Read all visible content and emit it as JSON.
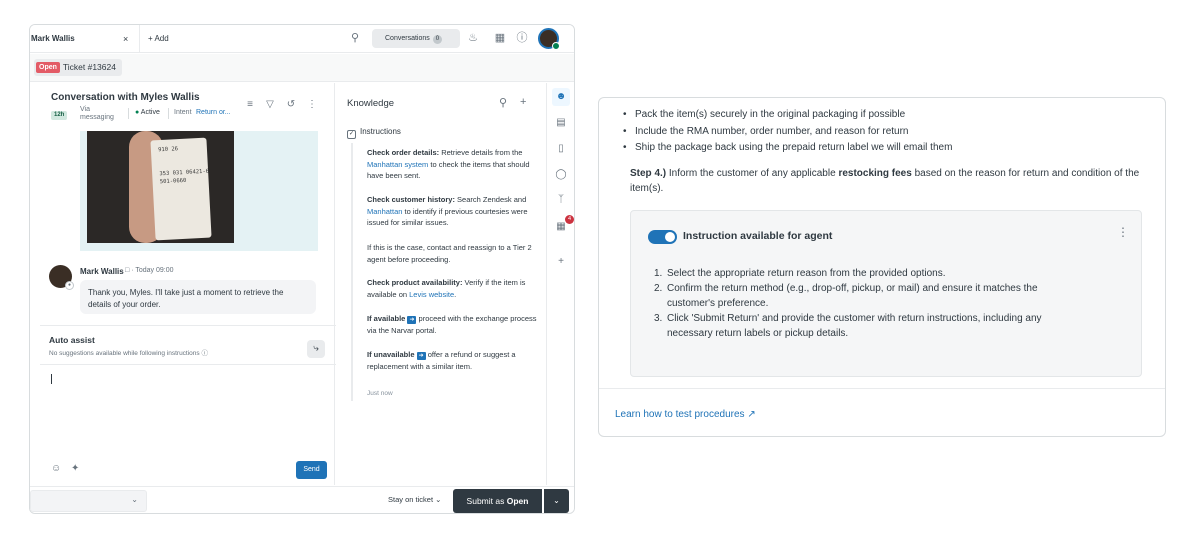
{
  "topbar": {
    "tab_label": "Mark Wallis",
    "tab_close": "×",
    "add_label": "+ Add",
    "conversations_label": "Conversations",
    "conversations_count": "0"
  },
  "ticket": {
    "status": "Open",
    "label": "Ticket #13624"
  },
  "conversation": {
    "title": "Conversation with Myles Wallis",
    "age_badge": "12h",
    "via": "Via messaging",
    "status": "Active",
    "intent_label": "Intent",
    "intent_value": "Return or...",
    "image_text": "910 26\n\n353 031 06421-6\n501-0660",
    "message": {
      "author": "Mark Wallis",
      "time": "· Today 09:00",
      "text": "Thank you, Myles. I'll take just a moment to retrieve the details of your order."
    },
    "auto_assist": {
      "title": "Auto assist",
      "subtitle": "No suggestions available while following instructions"
    },
    "send_label": "Send"
  },
  "knowledge": {
    "title": "Knowledge",
    "instructions_label": "Instructions",
    "p1_bold": "Check order details:",
    "p1_pre": " Retrieve details from the ",
    "p1_link": "Manhattan system",
    "p1_post": " to check the items that should have been sent.",
    "p2_bold": "Check customer history:",
    "p2_pre": " Search Zendesk and ",
    "p2_link": "Manhattan",
    "p2_post": " to identify if previous courtesies were issued for similar issues.",
    "p3": "If this is the case, contact and reassign to a Tier 2 agent before proceeding.",
    "p4_bold": "Check product availability:",
    "p4_pre": " Verify if the item is available on ",
    "p4_link": "Levis website",
    "p4_post": ".",
    "p5_bold": "If available",
    "p5_post": " proceed with the exchange process via the Narvar portal.",
    "p6_bold": "If unavailable",
    "p6_post": " offer a refund or suggest a replacement with a similar item.",
    "timestamp": "Just now"
  },
  "rail": {
    "badge_count": "4"
  },
  "footer": {
    "stay_label": "Stay on ticket",
    "submit_prefix": "Submit as ",
    "submit_status": "Open"
  },
  "card": {
    "bullets": [
      "Pack the item(s) securely in the original packaging if possible",
      "Include the RMA number, order number, and reason for return",
      "Ship the package back using the prepaid return label we will email them"
    ],
    "step4_label": "Step 4.)",
    "step4_pre": " Inform the customer of any applicable ",
    "step4_bold": "restocking fees",
    "step4_post": " based on the reason for return and condition of the item(s).",
    "toggle_label": "Instruction available for agent",
    "steps": [
      "Select the appropriate return reason from the provided options.",
      "Confirm the return method (e.g., drop-off, pickup, or mail) and ensure it matches the customer's preference.",
      "Click 'Submit Return' and provide the customer with return instructions, including any necessary return labels or pickup details."
    ],
    "learn_link": "Learn how to test procedures"
  },
  "colors": {
    "brand_blue": "#1f73b7",
    "open_red": "#e35b66",
    "active_green": "#038153",
    "submit_dark": "#2f3941"
  },
  "icons": [
    "search-icon",
    "bell-icon",
    "apps-icon",
    "help-icon",
    "filter-icon",
    "history-icon",
    "more-icon",
    "plus-icon",
    "user-icon",
    "smile-icon",
    "magic-icon",
    "chevron-down-icon",
    "external-link-icon"
  ]
}
